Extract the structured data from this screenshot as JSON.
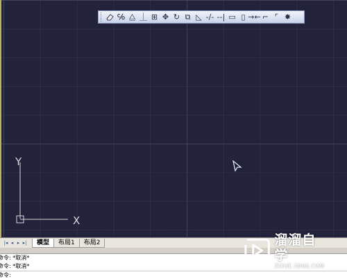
{
  "toolbar": {
    "items": [
      {
        "name": "erase-icon",
        "glyph": ""
      },
      {
        "name": "copy-object-icon",
        "glyph": "℅"
      },
      {
        "name": "mirror-icon",
        "glyph": "⧋"
      },
      {
        "name": "offset-icon",
        "glyph": "⏊"
      },
      {
        "name": "array-icon",
        "glyph": "⊞"
      },
      {
        "name": "move-icon",
        "glyph": "✥"
      },
      {
        "name": "rotate-icon",
        "glyph": "↻"
      },
      {
        "name": "scale-icon",
        "glyph": "⧉"
      },
      {
        "name": "stretch-icon",
        "glyph": "◺"
      },
      {
        "name": "trim-icon",
        "glyph": "-/-"
      },
      {
        "name": "extend-icon",
        "glyph": "--|"
      },
      {
        "name": "break-at-point-icon",
        "glyph": "▭"
      },
      {
        "name": "break-icon",
        "glyph": "▯"
      },
      {
        "name": "join-icon",
        "glyph": "→←"
      },
      {
        "name": "chamfer-icon",
        "glyph": "⌐"
      },
      {
        "name": "fillet-icon",
        "glyph": "⌜"
      },
      {
        "name": "explode-icon",
        "glyph": "✸"
      }
    ]
  },
  "ucs": {
    "x_label": "X",
    "y_label": "Y"
  },
  "tabs": {
    "nav": [
      "|◂",
      "◂",
      "▸",
      "▸|"
    ],
    "items": [
      {
        "label": "模型",
        "active": true
      },
      {
        "label": "布局1",
        "active": false
      },
      {
        "label": "布局2",
        "active": false
      }
    ]
  },
  "command": {
    "history": [
      "命令: *取消*",
      "命令: *取消*"
    ],
    "prompt": "命令:"
  },
  "watermark": {
    "title": "溜溜自学",
    "url": "ZIXUE.3D66.COM"
  },
  "colors": {
    "canvas_bg": "#22223a",
    "toolbar_bg": "#dbe2f2",
    "tabbar_bg": "#e8e6dd"
  }
}
